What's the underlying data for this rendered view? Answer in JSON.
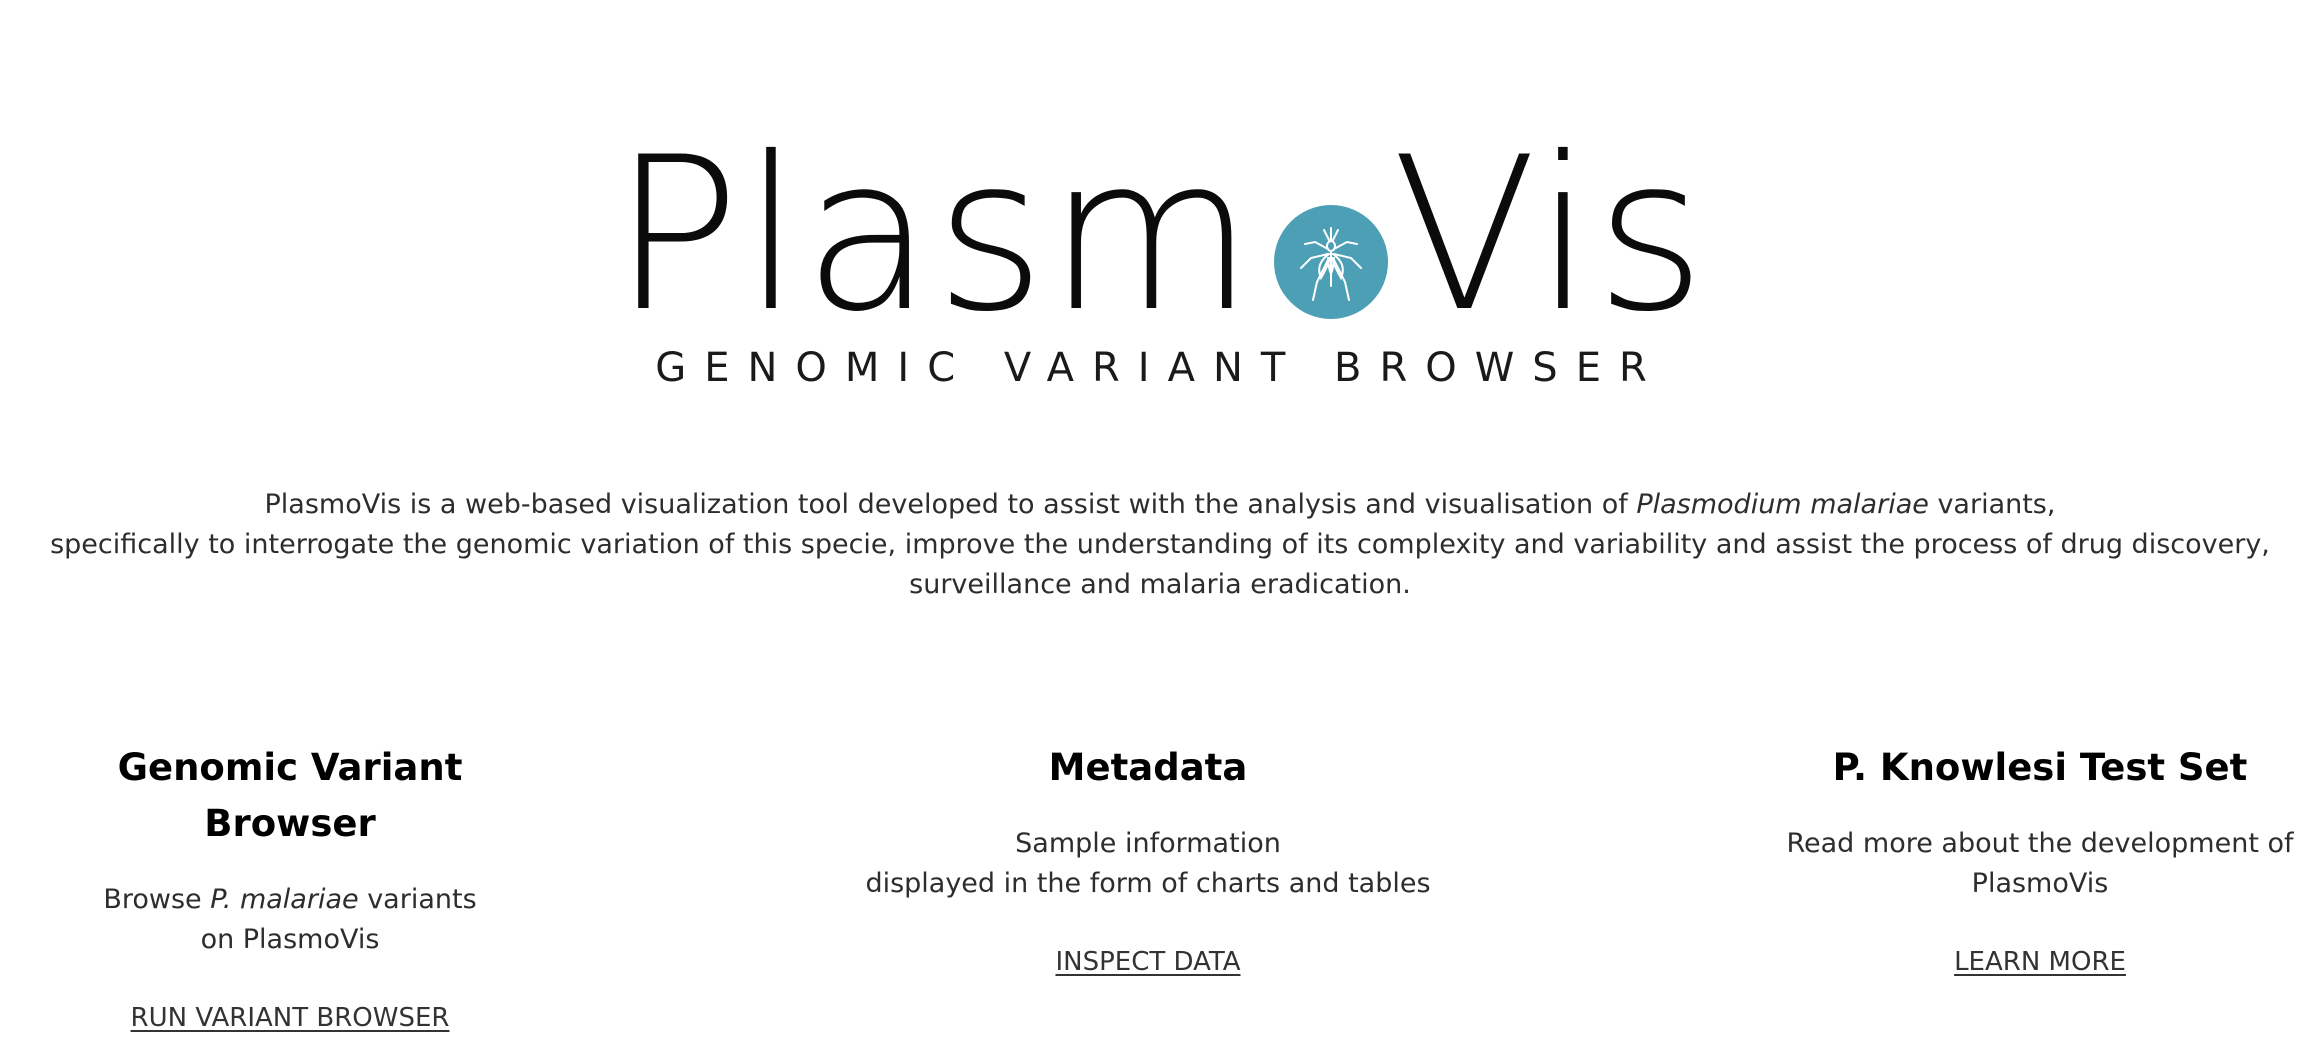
{
  "branding": {
    "logo_left": "Plasm",
    "logo_right": "Vis",
    "tagline": "GENOMIC VARIANT BROWSER",
    "accent_color": "#4c9fb4",
    "logo_icon": "mosquito-icon"
  },
  "intro": {
    "part1": "PlasmoVis is a web-based visualization tool developed to assist with the analysis and visualisation of ",
    "species": "Plasmodium malariae",
    "part2": " variants,",
    "line2": "specifically to interrogate the genomic variation of this specie, improve the understanding of its complexity and variability and assist the process of drug discovery,",
    "line3": "surveillance and malaria eradication."
  },
  "features": {
    "variant_browser": {
      "title": "Genomic Variant Browser",
      "blurb_prefix": "Browse ",
      "blurb_species": "P. malariae",
      "blurb_suffix": " variants",
      "blurb_line2": "on PlasmoVis",
      "link": "RUN VARIANT BROWSER"
    },
    "metadata": {
      "title": "Metadata",
      "blurb_line1": "Sample information",
      "blurb_line2": "displayed in the form of charts and tables",
      "link": "INSPECT DATA"
    },
    "knowlesi": {
      "title": "P. Knowlesi Test Set",
      "blurb_line1": "Read more about the development of",
      "blurb_line2": "PlasmoVis",
      "link": "LEARN MORE"
    }
  }
}
